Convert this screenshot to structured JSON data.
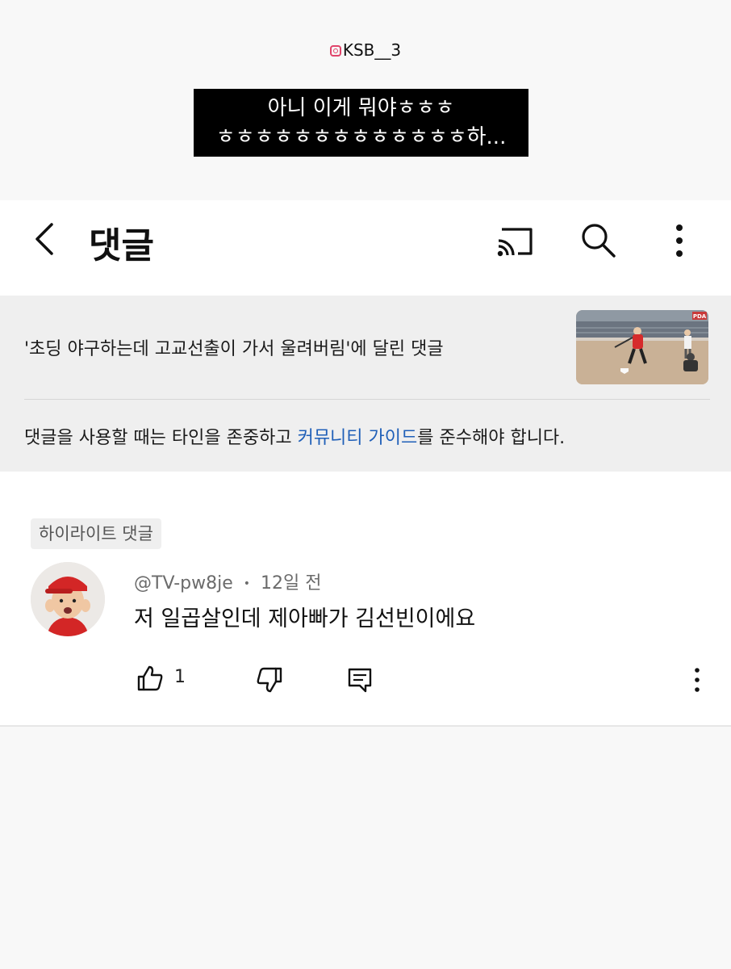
{
  "story": {
    "handle": "KSB__3",
    "caption_line1": "아니 이게 뭐야ㅎㅎㅎ",
    "caption_line2": "ㅎㅎㅎㅎㅎㅎㅎㅎㅎㅎㅎㅎㅎ하..."
  },
  "header": {
    "title": "댓글",
    "icons": [
      "back-icon",
      "cast-icon",
      "search-icon",
      "more-vert-icon"
    ]
  },
  "info": {
    "video_line": "'초딩 야구하는데 고교선출이 가서 울려버림'에 달린 댓글",
    "thumbnail_badge": "PDA",
    "guide_prefix": "댓글을 사용할 때는 타인을 존중하고 ",
    "guide_link": "커뮤니티 가이드",
    "guide_suffix": "를 준수해야 합니다.",
    "link_color": "#1f5fb8"
  },
  "comment": {
    "badge": "하이라이트 댓글",
    "author": "@TV-pw8je",
    "separator": "•",
    "time": "12일 전",
    "text": "저 일곱살인데 제아빠가 김선빈이에요",
    "likes": "1"
  }
}
